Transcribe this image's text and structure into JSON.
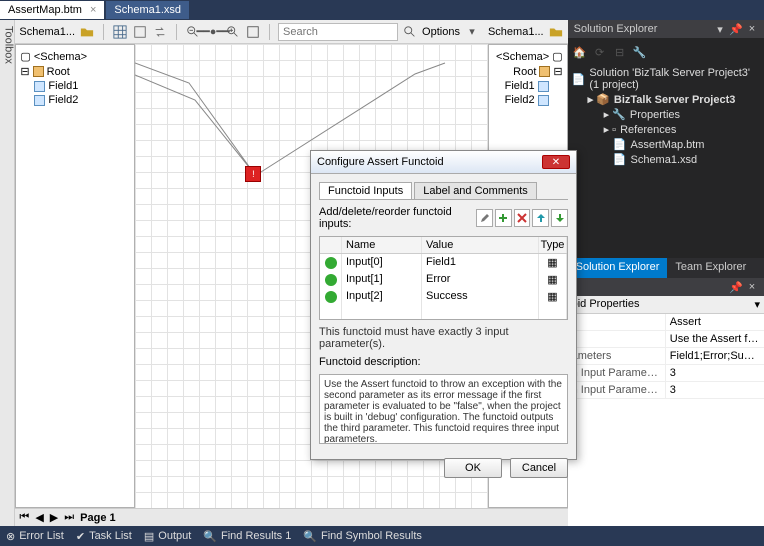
{
  "tabs": {
    "active": "AssertMap.btm",
    "inactive": "Schema1.xsd"
  },
  "toolbar": {
    "left_label": "Schema1...",
    "right_label": "Schema1...",
    "search_placeholder": "Search",
    "options_label": "Options"
  },
  "source_schema": {
    "root_tag": "<Schema>",
    "root": "Root",
    "fields": [
      "Field1",
      "Field2"
    ]
  },
  "dest_schema": {
    "root_tag": "<Schema>",
    "root": "Root",
    "fields": [
      "Field1",
      "Field2"
    ]
  },
  "page_nav": {
    "label": "Page 1"
  },
  "solution_explorer": {
    "title": "Solution Explorer",
    "solution": "Solution 'BizTalk Server Project3' (1 project)",
    "project": "BizTalk Server Project3",
    "items": [
      "Properties",
      "References",
      "AssertMap.btm",
      "Schema1.xsd"
    ]
  },
  "explorer_tabs": {
    "active": "Solution Explorer",
    "other": "Team Explorer"
  },
  "properties": {
    "title": "oid Properties",
    "rows": [
      {
        "k": "s",
        "v": "Assert"
      },
      {
        "k": "s",
        "v": "Use the Assert functoid to throw an"
      },
      {
        "k": "ameters",
        "v": "Field1;Error;Success"
      },
      {
        "k": "n Input Parameters",
        "v": "3"
      },
      {
        "k": "n Input Parameters",
        "v": "3"
      }
    ]
  },
  "dialog": {
    "title": "Configure Assert Functoid",
    "tab_inputs": "Functoid Inputs",
    "tab_label": "Label and Comments",
    "reorder_label": "Add/delete/reorder functoid inputs:",
    "columns": {
      "name": "Name",
      "value": "Value",
      "type": "Type"
    },
    "rows": [
      {
        "name": "Input[0]",
        "value": "Field1"
      },
      {
        "name": "Input[1]",
        "value": "Error"
      },
      {
        "name": "Input[2]",
        "value": "Success"
      }
    ],
    "note": "This functoid must have exactly 3 input parameter(s).",
    "desc_label": "Functoid description:",
    "desc": "Use the Assert functoid to throw an exception with the second parameter as its error message if the first parameter is evaluated to be \"false\", when the project is built in 'debug' configuration. The functoid outputs the third parameter. This functoid requires three input parameters.",
    "ok": "OK",
    "cancel": "Cancel"
  },
  "statusbar": {
    "items": [
      "Error List",
      "Task List",
      "Output",
      "Find Results 1",
      "Find Symbol Results"
    ]
  }
}
